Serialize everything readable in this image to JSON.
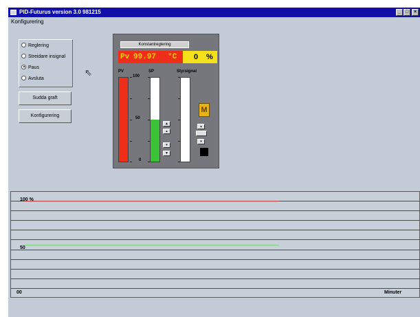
{
  "window": {
    "title": "PID-Futurus version 3.0 981215",
    "controls": {
      "minimize": "_",
      "maximize": "□",
      "close": "×"
    }
  },
  "menu": {
    "items": [
      "Konfigurering"
    ]
  },
  "mode": {
    "options": [
      "Reglering",
      "Streidare insignal",
      "Paus",
      "Avsluta"
    ],
    "selected": "Paus"
  },
  "buttons": {
    "hide_graph": "Sudda graft",
    "configure": "Konfigurering"
  },
  "controller": {
    "header": "Konstantreglering",
    "pv_prefix": "Pv",
    "pv_value": "99.97",
    "pv_unit": "°C",
    "output_value": "0",
    "output_unit": "%",
    "labels": {
      "pv": "PV",
      "sp": "SP",
      "output": "Styrsignal"
    },
    "scale": {
      "max": "100",
      "mid": "50",
      "min": "0"
    },
    "levels": {
      "pv": 1.0,
      "sp": 0.5,
      "output": 0.0
    },
    "manual": "M",
    "colors": {
      "pv": "#ef2e1a",
      "sp": "#3ac236",
      "output": "#f5e11a",
      "manual": "#e8b414"
    }
  },
  "graph": {
    "label_top": "100 %",
    "label_mid": "50",
    "label_left_bottom": "00",
    "label_right_bottom": "Minuter",
    "trace_levels": {
      "pv": 1.0,
      "sp": 0.5
    },
    "trace_colors": {
      "pv": "#c73a3a",
      "sp": "#7fd07f"
    }
  }
}
